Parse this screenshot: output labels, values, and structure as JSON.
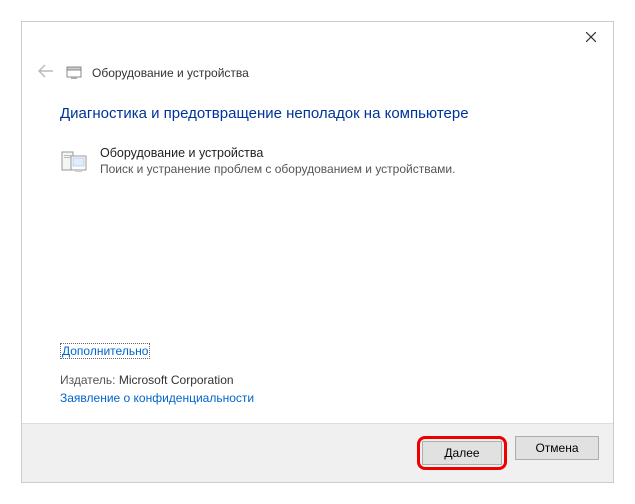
{
  "header": {
    "title": "Оборудование и устройства"
  },
  "content": {
    "main_heading": "Диагностика и предотвращение неполадок на компьютере",
    "item_title": "Оборудование и устройства",
    "item_desc": "Поиск и устранение проблем с оборудованием и устройствами."
  },
  "links": {
    "advanced": "Дополнительно",
    "privacy": "Заявление о конфиденциальности"
  },
  "publisher": {
    "label": "Издатель:",
    "name": "Microsoft Corporation"
  },
  "buttons": {
    "next": "Далее",
    "cancel": "Отмена"
  }
}
